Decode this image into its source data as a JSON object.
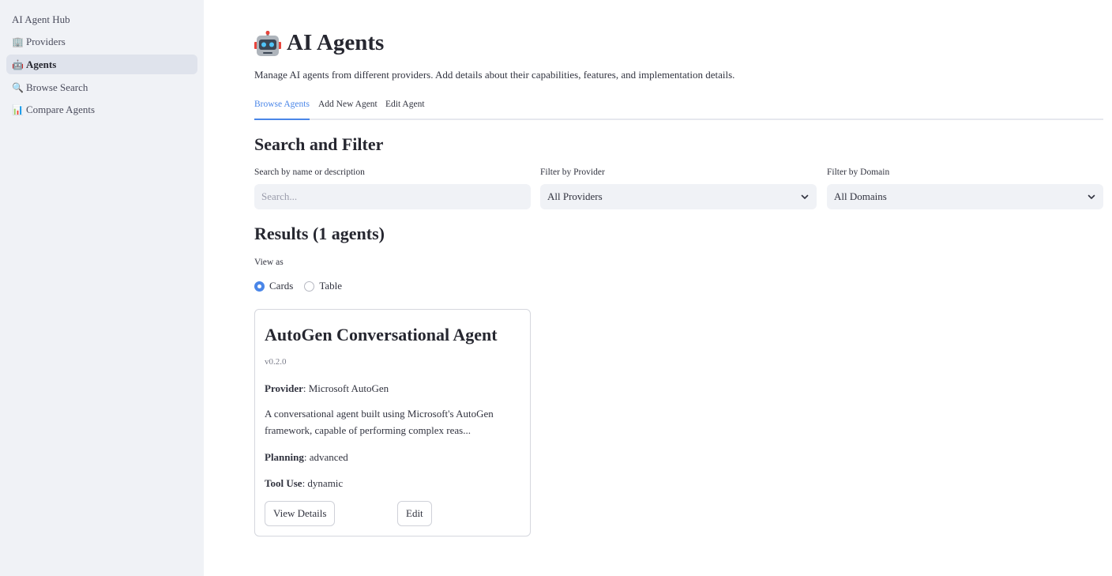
{
  "sidebar": {
    "app_title": "AI Agent Hub",
    "items": [
      {
        "icon": "building-icon",
        "glyph": "🏢",
        "label": "Providers",
        "active": false
      },
      {
        "icon": "robot-icon",
        "glyph": "🤖",
        "label": "Agents",
        "active": true
      },
      {
        "icon": "magnifier-icon",
        "glyph": "🔍",
        "label": "Browse Search",
        "active": false
      },
      {
        "icon": "bar-chart-icon",
        "glyph": "📊",
        "label": "Compare Agents",
        "active": false
      }
    ]
  },
  "header": {
    "title": "AI Agents",
    "subtitle": "Manage AI agents from different providers. Add details about their capabilities, features, and implementation details."
  },
  "tabs": [
    {
      "label": "Browse Agents",
      "active": true
    },
    {
      "label": "Add New Agent",
      "active": false
    },
    {
      "label": "Edit Agent",
      "active": false
    }
  ],
  "filters": {
    "section_title": "Search and Filter",
    "search_label": "Search by name or description",
    "search_placeholder": "Search...",
    "search_value": "",
    "provider_label": "Filter by Provider",
    "provider_value": "All Providers",
    "domain_label": "Filter by Domain",
    "domain_value": "All Domains"
  },
  "results": {
    "title": "Results (1 agents)",
    "view_label": "View as",
    "view_options": [
      {
        "label": "Cards",
        "selected": true
      },
      {
        "label": "Table",
        "selected": false
      }
    ]
  },
  "agent_card": {
    "name": "AutoGen Conversational Agent",
    "version": "v0.2.0",
    "provider_key": "Provider",
    "provider_value": ": Microsoft AutoGen",
    "description": "A conversational agent built using Microsoft's AutoGen framework, capable of performing complex reas...",
    "planning_key": "Planning",
    "planning_value": ": advanced",
    "tool_use_key": "Tool Use",
    "tool_use_value": ": dynamic",
    "view_details_label": "View Details",
    "edit_label": "Edit"
  },
  "colors": {
    "accent": "#4a86e8",
    "sidebar_bg": "#f0f2f6",
    "text": "#31333f"
  }
}
